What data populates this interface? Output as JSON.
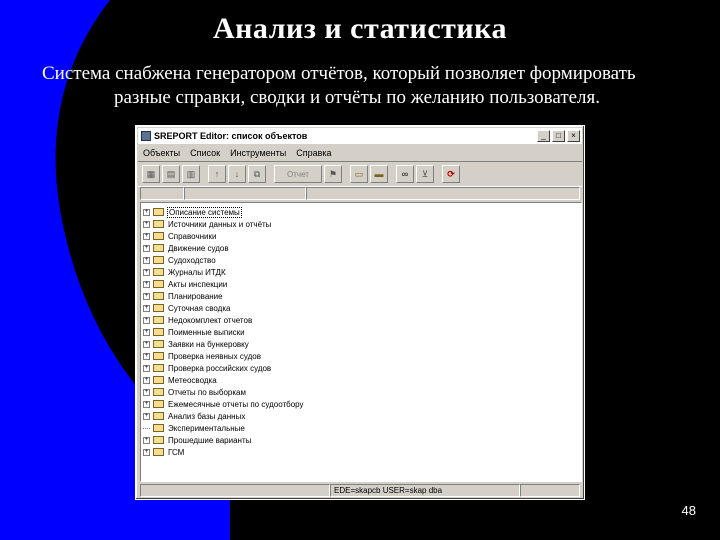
{
  "slide": {
    "title": "Анализ и статистика",
    "body_line1": "Система снабжена генератором отчётов, который позволяет формировать",
    "body_line2": "разные справки, сводки и отчёты по желанию пользователя.",
    "page_number": "48"
  },
  "window": {
    "title": "SREPORT Editor: список объектов",
    "minimize": "_",
    "maximize": "□",
    "close": "×",
    "menu": [
      "Объекты",
      "Список",
      "Инструменты",
      "Справка"
    ],
    "toolbar_wide_label": "Отчет",
    "tree_items": [
      "Описание системы",
      "Источники данных и отчёты",
      "Справочники",
      "Движение судов",
      "Судоходство",
      "Журналы ИТДК",
      "Акты инспекции",
      "Планирование",
      "Суточная сводка",
      "Недокомплект отчетов",
      "Поименные выписки",
      "Заявки на бункеровку",
      "Проверка неявных судов",
      "Проверка российских судов",
      "Метеосводка",
      "Отчеты по выборкам",
      "Ежемесячные отчеты по судоотбору",
      "Анализ базы данных",
      "Экспериментальные",
      "Прошедшие варианты",
      "ГСМ"
    ],
    "status": "EDE=skapcb USER=skap dba"
  },
  "colors": {
    "background": "#000000",
    "wave": "#0000ff",
    "window_face": "#d4d0c8"
  }
}
